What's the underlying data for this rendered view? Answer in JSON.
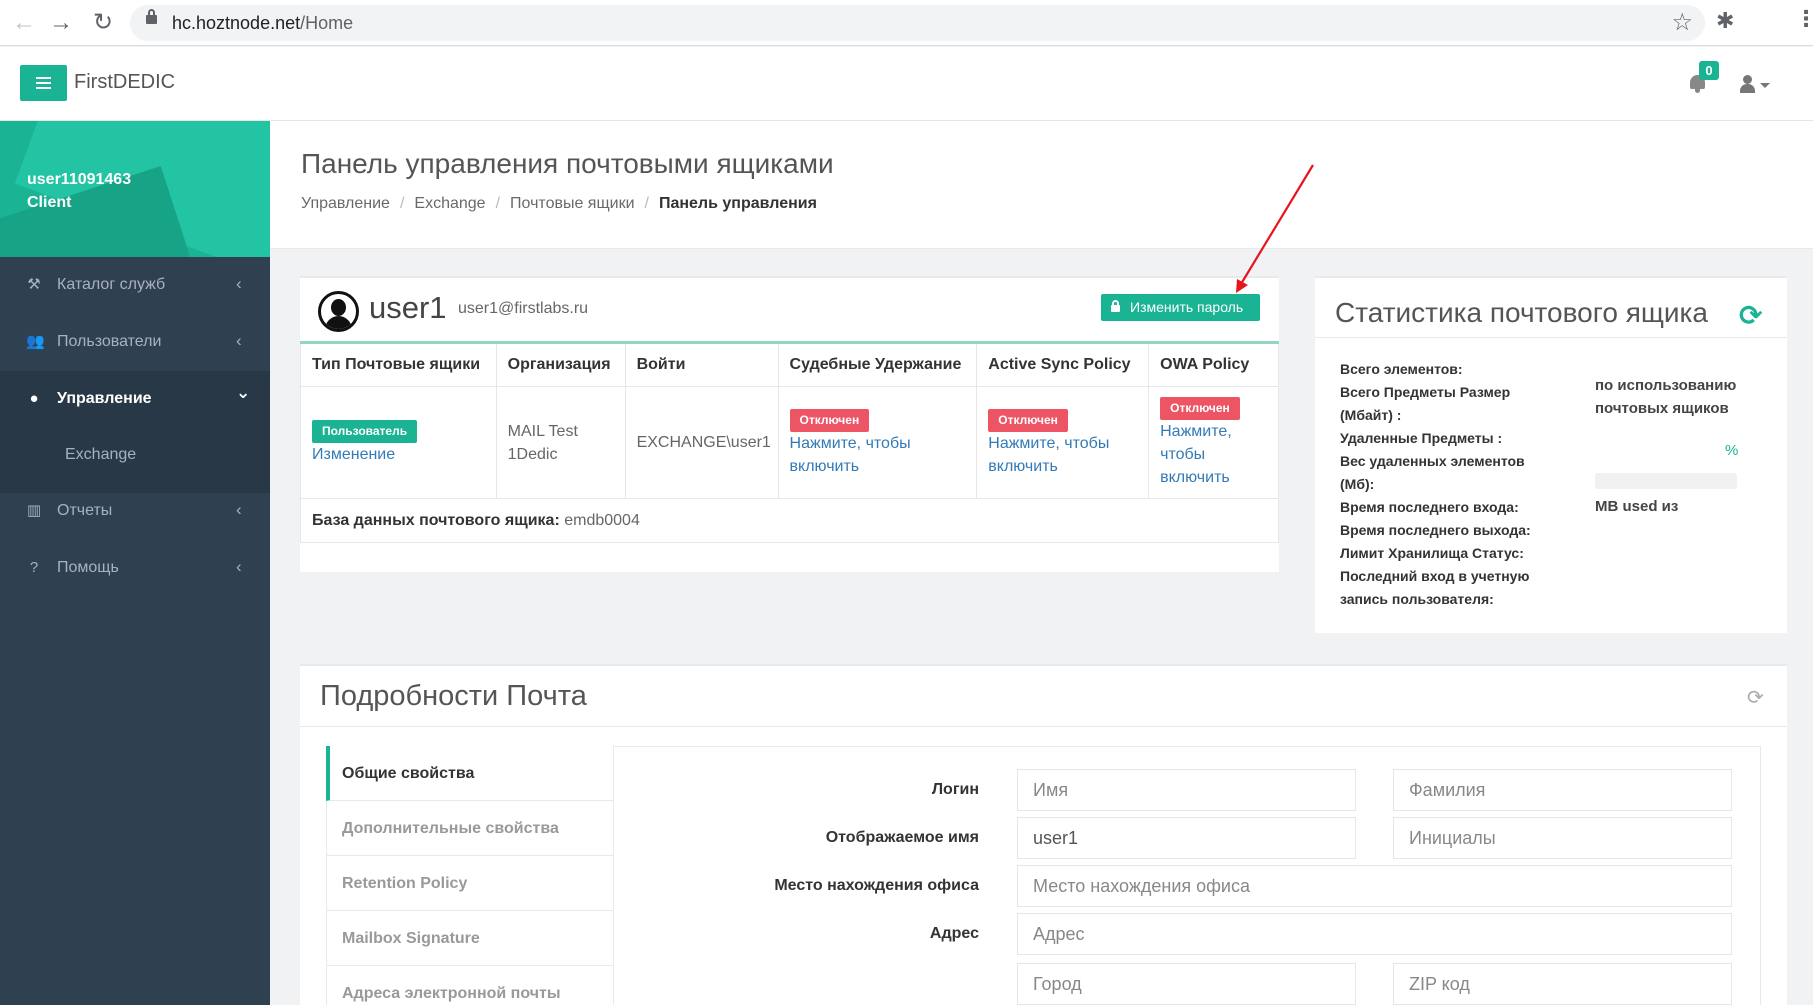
{
  "browser": {
    "url_host": "hc.hoztnode.net",
    "url_path": "/Home",
    "back_glyph": "←",
    "forward_glyph": "→",
    "reload_glyph": "↻",
    "star_glyph": "☆",
    "extensions_glyph": "✱",
    "menu_glyph": "⋮"
  },
  "header": {
    "brand": "FirstDEDIC",
    "notification_count": "0"
  },
  "sidebar": {
    "user_name": "user11091463",
    "user_role": "Client",
    "items": [
      {
        "label": "Каталог служб",
        "icon": "gavel-icon",
        "glyph": "⚒",
        "chevron": "‹"
      },
      {
        "label": "Пользователи",
        "icon": "users-icon",
        "glyph": "👥",
        "chevron": "‹"
      },
      {
        "label": "Управление",
        "icon": "globe-icon",
        "glyph": "●",
        "chevron": "⌄"
      },
      {
        "label": "Отчеты",
        "icon": "bar-chart-icon",
        "glyph": "▥",
        "chevron": "‹"
      },
      {
        "label": "Помощь",
        "icon": "question-circle-icon",
        "glyph": "?",
        "chevron": "‹"
      }
    ],
    "submenu_item": "Exchange"
  },
  "page": {
    "title": "Панель управления почтовыми ящиками",
    "breadcrumb": [
      "Управление",
      "Exchange",
      "Почтовые ящики",
      "Панель управления"
    ],
    "breadcrumb_sep": "/"
  },
  "mailbox": {
    "name": "user1",
    "email": "user1@firstlabs.ru",
    "change_password_label": "Изменить пароль",
    "columns": [
      "Тип Почтовые ящики",
      "Организация",
      "Войти",
      "Судебные Удержание",
      "Active Sync Policy",
      "OWA Policy"
    ],
    "type_badge": "Пользователь",
    "type_link": "Изменение",
    "organization": "MAIL Test 1Dedic",
    "login": "EXCHANGE\\user1",
    "disabled_label": "Отключен",
    "enable_link": "Нажмите, чтобы включить",
    "db_label": "База данных почтового ящика:",
    "db_value": "emdb0004"
  },
  "stats": {
    "title": "Статистика почтового ящика",
    "refresh_glyph": "⟳",
    "keys": [
      "Всего элементов:",
      "Всего Предметы Размер (Мбайт) :",
      "Удаленные Предметы :",
      "Вес удаленных элементов (Мб):",
      "Время последнего входа:",
      "Время последнего выхода:",
      "Лимит Хранилища Статус:",
      "Последний вход в учетную запись пользователя:"
    ],
    "usage_text": "по использованию почтовых ящиков",
    "percent_sign": "%",
    "usage_fraction": 0,
    "used_text": "MB used из"
  },
  "details": {
    "title": "Подробности Почта",
    "refresh_glyph": "⟳",
    "tabs": [
      "Общие свойства",
      "Дополнительные свойства",
      "Retention Policy",
      "Mailbox Signature",
      "Адреса электронной почты"
    ],
    "fields": {
      "login_label": "Логин",
      "first_name_placeholder": "Имя",
      "last_name_placeholder": "Фамилия",
      "display_name_label": "Отображаемое имя",
      "display_name_value": "user1",
      "initials_placeholder": "Инициалы",
      "office_label": "Место нахождения офиса",
      "office_placeholder": "Место нахождения офиса",
      "address_label": "Адрес",
      "address_placeholder": "Адрес",
      "city_placeholder": "Город",
      "zip_placeholder": "ZIP код"
    }
  },
  "colors": {
    "accent": "#1ab394",
    "sidebar": "#2f4050",
    "danger": "#ed5565",
    "link": "#337ab7",
    "annotation": "#e8141c"
  }
}
